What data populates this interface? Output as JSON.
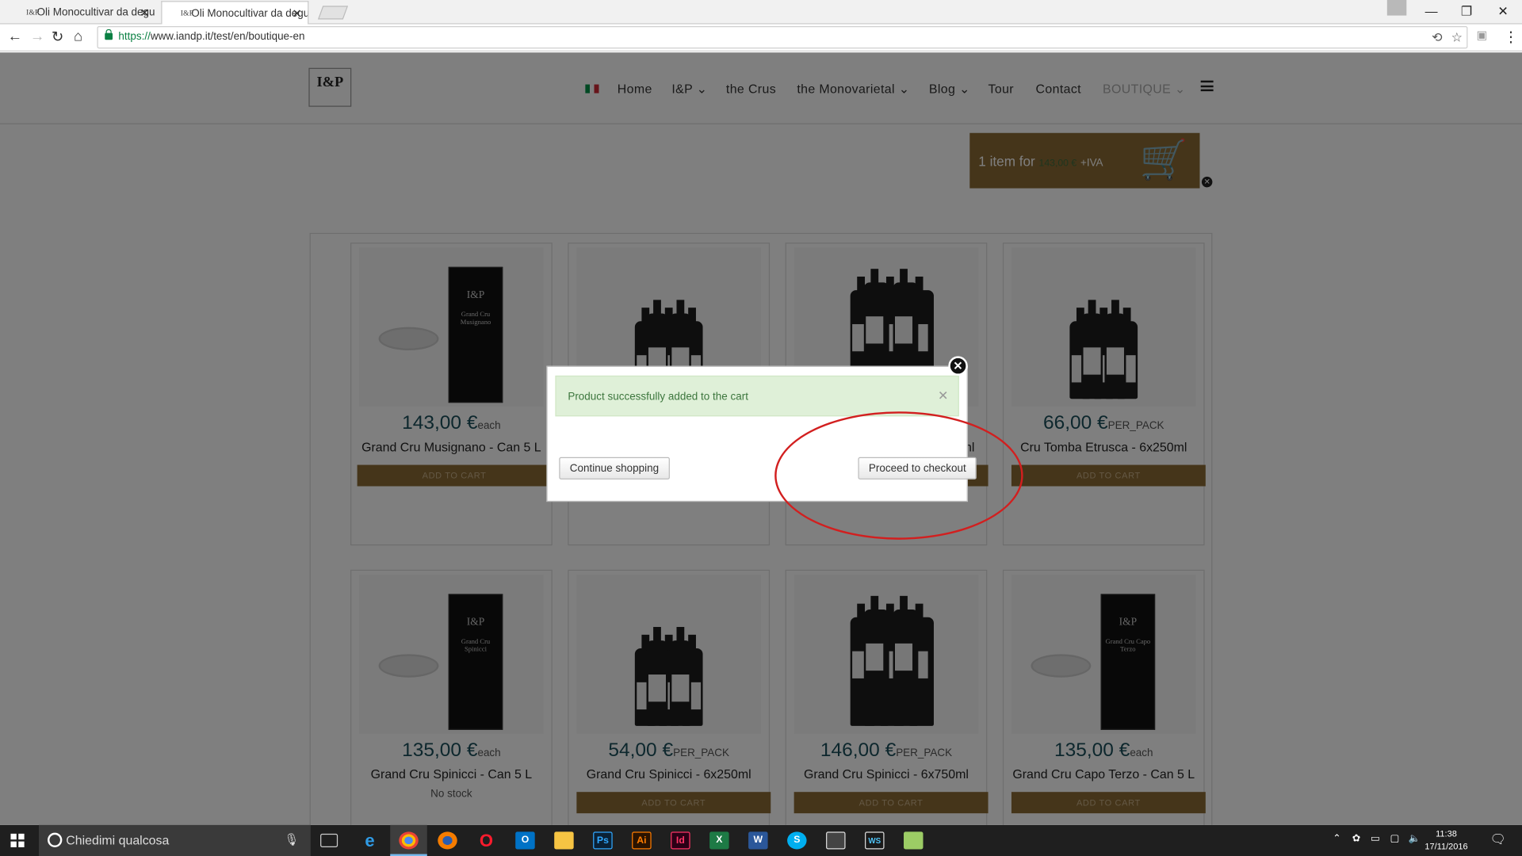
{
  "browser": {
    "tabs": [
      {
        "title": "Oli Monocultivar da degu",
        "active": false
      },
      {
        "title": "Oli Monocultivar da degu",
        "active": true
      }
    ],
    "favicon_text": "I&P",
    "url": {
      "scheme": "https://",
      "rest": "www.iandp.it/test/en/boutique-en"
    }
  },
  "site": {
    "logo": "I&P",
    "nav": [
      "Home",
      "I&P",
      "the Crus",
      "the Monovarietal",
      "Blog",
      "Tour",
      "Contact",
      "BOUTIQUE"
    ],
    "cart": {
      "prefix": "1 item for",
      "amount": "143,00 €",
      "suffix": "+IVA"
    },
    "add_to_cart": "ADD TO CART",
    "products": [
      {
        "price": "143,00 €",
        "unit": "each",
        "name": "Grand Cru Musignano - Can 5 L",
        "type": "can",
        "label": "Grand Cru Musignano"
      },
      {
        "price": "",
        "unit": "",
        "name": "",
        "type": "bottles-small"
      },
      {
        "price": "",
        "unit": "",
        "name": "",
        "type": "bottles-big",
        "name_tail": "ml"
      },
      {
        "price": "66,00 €",
        "unit": "PER_PACK",
        "name": "Cru Tomba Etrusca - 6x250ml",
        "type": "bottles-small"
      },
      {
        "price": "135,00 €",
        "unit": "each",
        "name": "Grand Cru Spinicci - Can 5 L",
        "type": "can",
        "label": "Grand Cru Spinicci",
        "stock": "No stock"
      },
      {
        "price": "54,00 €",
        "unit": "PER_PACK",
        "name": "Grand Cru Spinicci - 6x250ml",
        "type": "bottles-small"
      },
      {
        "price": "146,00 €",
        "unit": "PER_PACK",
        "name": "Grand Cru Spinicci - 6x750ml",
        "type": "bottles-big"
      },
      {
        "price": "135,00 €",
        "unit": "each",
        "name": "Grand Cru Capo Terzo - Can 5 L",
        "type": "can",
        "label": "Grand Cru Capo Terzo"
      }
    ]
  },
  "modal": {
    "message": "Product successfully added to the cart",
    "continue_label": "Continue shopping",
    "checkout_label": "Proceed to checkout"
  },
  "taskbar": {
    "search_placeholder": "Chiedimi qualcosa",
    "time": "11:38",
    "date": "17/11/2016",
    "apps": [
      "ie",
      "chrome",
      "firefox",
      "opera",
      "outlook",
      "explorer",
      "Ps",
      "Ai",
      "Id",
      "X",
      "W",
      "S",
      "photos",
      "WS",
      "notepad"
    ]
  },
  "colors": {
    "brand": "#8a6a35",
    "price": "#1b4f5b",
    "alert_bg": "#dff0d8",
    "alert_text": "#3c763d",
    "highlight": "#d21f1f"
  }
}
